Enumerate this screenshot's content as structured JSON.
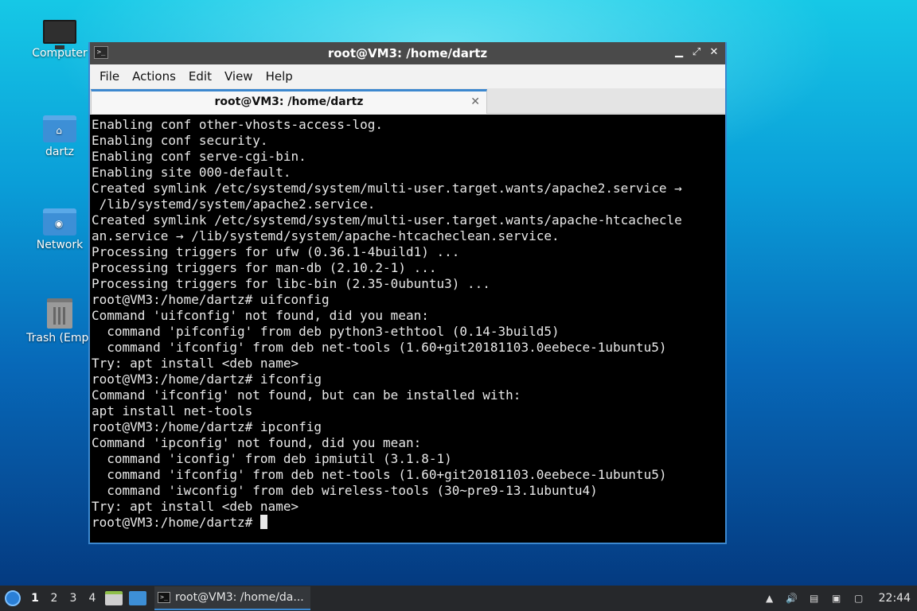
{
  "desktop": {
    "icons": [
      {
        "label": "Computer",
        "icon": "computer-icon"
      },
      {
        "label": "dartz",
        "icon": "home-folder-icon"
      },
      {
        "label": "Network",
        "icon": "network-folder-icon"
      },
      {
        "label": "Trash (Empt",
        "icon": "trash-icon"
      }
    ]
  },
  "window": {
    "title": "root@VM3: /home/dartz",
    "controls": {
      "minimize": "▁",
      "maximize": "⤢",
      "close": "✕"
    },
    "menu": [
      "File",
      "Actions",
      "Edit",
      "View",
      "Help"
    ],
    "tab": {
      "label": "root@VM3: /home/dartz",
      "close": "✕"
    },
    "terminal_lines": [
      "Enabling conf other-vhosts-access-log.",
      "Enabling conf security.",
      "Enabling conf serve-cgi-bin.",
      "Enabling site 000-default.",
      "Created symlink /etc/systemd/system/multi-user.target.wants/apache2.service →",
      " /lib/systemd/system/apache2.service.",
      "Created symlink /etc/systemd/system/multi-user.target.wants/apache-htcachecle",
      "an.service → /lib/systemd/system/apache-htcacheclean.service.",
      "Processing triggers for ufw (0.36.1-4build1) ...",
      "Processing triggers for man-db (2.10.2-1) ...",
      "Processing triggers for libc-bin (2.35-0ubuntu3) ...",
      "root@VM3:/home/dartz# uifconfig",
      "Command 'uifconfig' not found, did you mean:",
      "  command 'pifconfig' from deb python3-ethtool (0.14-3build5)",
      "  command 'ifconfig' from deb net-tools (1.60+git20181103.0eebece-1ubuntu5)",
      "Try: apt install <deb name>",
      "root@VM3:/home/dartz# ifconfig",
      "Command 'ifconfig' not found, but can be installed with:",
      "apt install net-tools",
      "root@VM3:/home/dartz# ipconfig",
      "Command 'ipconfig' not found, did you mean:",
      "  command 'iconfig' from deb ipmiutil (3.1.8-1)",
      "  command 'ifconfig' from deb net-tools (1.60+git20181103.0eebece-1ubuntu5)",
      "  command 'iwconfig' from deb wireless-tools (30~pre9-13.1ubuntu4)",
      "Try: apt install <deb name>"
    ],
    "prompt": "root@VM3:/home/dartz# "
  },
  "taskbar": {
    "workspaces": [
      "1",
      "2",
      "3",
      "4"
    ],
    "task_label": "root@VM3: /home/da...",
    "clock": "22:44"
  },
  "colors": {
    "accent": "#3c88cf",
    "terminal_bg": "#000000",
    "taskbar_bg": "#26282b"
  }
}
